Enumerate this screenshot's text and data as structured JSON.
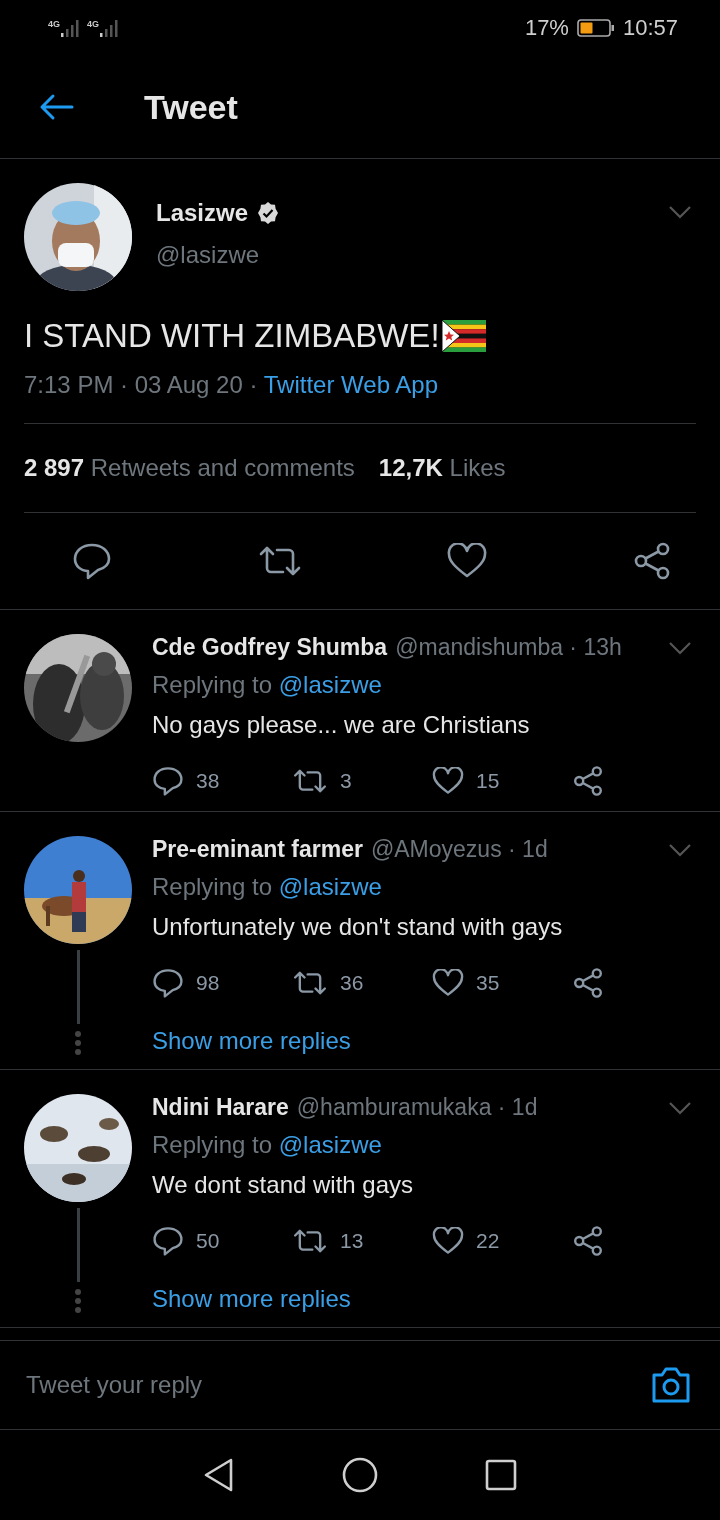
{
  "status_bar": {
    "networks": [
      "4G",
      "4G"
    ],
    "battery": "17%",
    "time": "10:57"
  },
  "header": {
    "title": "Tweet"
  },
  "tweet": {
    "name": "Lasizwe",
    "verified": true,
    "handle": "@lasizwe",
    "text": "I STAND WITH ZIMBABWE!",
    "meta": "7:13 PM · 03 Aug 20 ·",
    "source": "Twitter Web App",
    "stats": [
      {
        "count": "2 897",
        "label": "Retweets and comments"
      },
      {
        "count": "12,7K",
        "label": "Likes"
      }
    ]
  },
  "replies": [
    {
      "name": "Cde Godfrey Shumba",
      "meta": "@mandishumba · 13h",
      "replying": "Replying to",
      "mention": "@lasizwe",
      "text": "No gays please... we are Christians",
      "replies": "38",
      "retweets": "3",
      "likes": "15"
    },
    {
      "name": "Pre-eminant farmer",
      "meta": "@AMoyezus · 1d",
      "replying": "Replying to",
      "mention": "@lasizwe",
      "text": "Unfortunately we don't stand with gays",
      "replies": "98",
      "retweets": "36",
      "likes": "35",
      "show_more": "Show more replies"
    },
    {
      "name": "Ndini Harare",
      "meta": "@hamburamukaka · 1d",
      "replying": "Replying to",
      "mention": "@lasizwe",
      "text": "We dont stand with gays",
      "replies": "50",
      "retweets": "13",
      "likes": "22",
      "show_more": "Show more replies"
    }
  ],
  "composer": {
    "placeholder": "Tweet your reply"
  }
}
